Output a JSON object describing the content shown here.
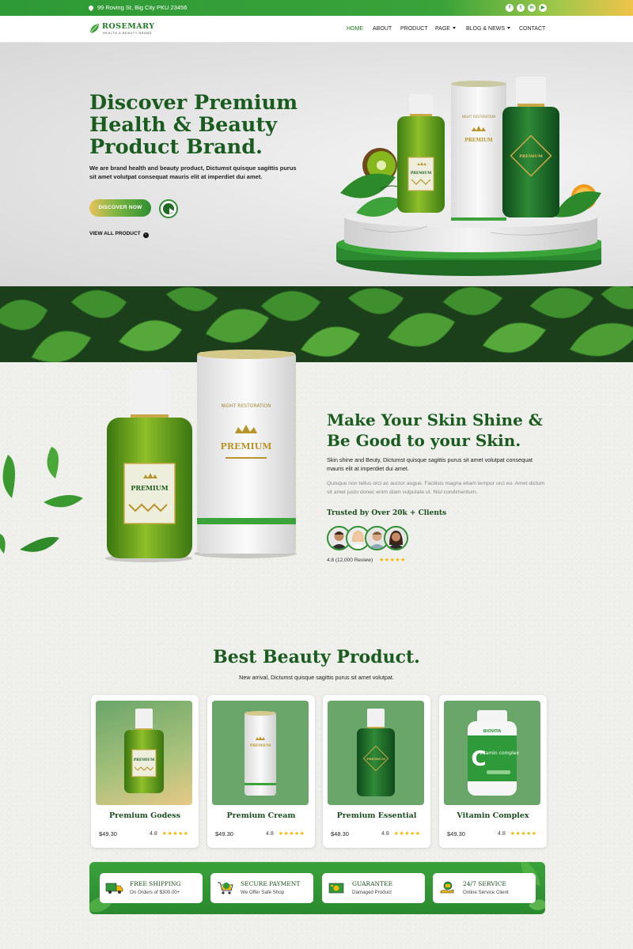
{
  "topbar": {
    "address": "99 Roving St, Big City PKU 23456",
    "social_icons": [
      "facebook-icon",
      "twitter-icon",
      "linkedin-icon",
      "youtube-icon"
    ]
  },
  "brand": {
    "name": "ROSEMARY",
    "tagline": "HEALTH & BEAUTY BRAND",
    "accent_color": "#1f7a24",
    "gold_color": "#e7c25a"
  },
  "nav": {
    "items": [
      {
        "label": "HOME",
        "active": true
      },
      {
        "label": "ABOUT"
      },
      {
        "label": "PRODUCT"
      },
      {
        "label": "PAGE",
        "dropdown": true
      },
      {
        "label": "BLOG & NEWS",
        "dropdown": true
      },
      {
        "label": "CONTACT"
      }
    ]
  },
  "hero": {
    "title": "Discover Premium Health & Beauty Product Brand.",
    "description": "We are brand health and beauty product, Dictumst quisque sagittis purus sit amet volutpat consequat mauris elit at imperdiet dui amet.",
    "cta_label": "DISCOVER NOW",
    "view_all_label": "VIEW ALL PRODUCT"
  },
  "skin": {
    "title": "Make Your Skin Shine & Be Good to your Skin.",
    "description": "Skin shine and Beuty, Dictumst quisque sagittis purus sit amet volutpat consequat mauris elit at imperdiet dui amet.",
    "description2": "Quisque non tellus orci ac auctor augue. Facilisis magna etiam tempor orci eu. Amet dictum sit amet justo donec enim diam vulputate ut. Nisl condimentum.",
    "trusted": "Trusted by Over 20k + Clients",
    "rating": "4.8 (12,000 Review)",
    "stars": "★★★★★"
  },
  "best": {
    "title": "Best Beauty Product.",
    "subtitle": "New arrival, Dictumst quisque sagittis purus sit amet volutpat."
  },
  "products": [
    {
      "name": "Premium Godess",
      "price": "$49.30",
      "rating": "4.8",
      "stars": "★★★★★"
    },
    {
      "name": "Premium Cream",
      "price": "$49.30",
      "rating": "4.8",
      "stars": "★★★★★"
    },
    {
      "name": "Premium Essential",
      "price": "$48.30",
      "rating": "4.8",
      "stars": "★★★★★"
    },
    {
      "name": "Vitamin Complex",
      "price": "$49.30",
      "rating": "4.8",
      "stars": "★★★★★"
    }
  ],
  "features": [
    {
      "title": "FREE SHIPPING",
      "subtitle": "On Orders of $300.00+",
      "icon": "truck-icon"
    },
    {
      "title": "SECURE PAYMENT",
      "subtitle": "We Offer Safe Shop",
      "icon": "cart-icon"
    },
    {
      "title": "GUARANTEE",
      "subtitle": "Damaged Product",
      "icon": "money-icon"
    },
    {
      "title": "24/7 SERVICE",
      "subtitle": "Online Service Client",
      "icon": "support-icon"
    }
  ],
  "bottle_labels": {
    "premium": "PREMIUM",
    "night": "NIGHT RESTORATION",
    "vitamin_brand": "BIOVITA",
    "vitamin_c": "C",
    "vitamin_text": "vitamin complex"
  }
}
